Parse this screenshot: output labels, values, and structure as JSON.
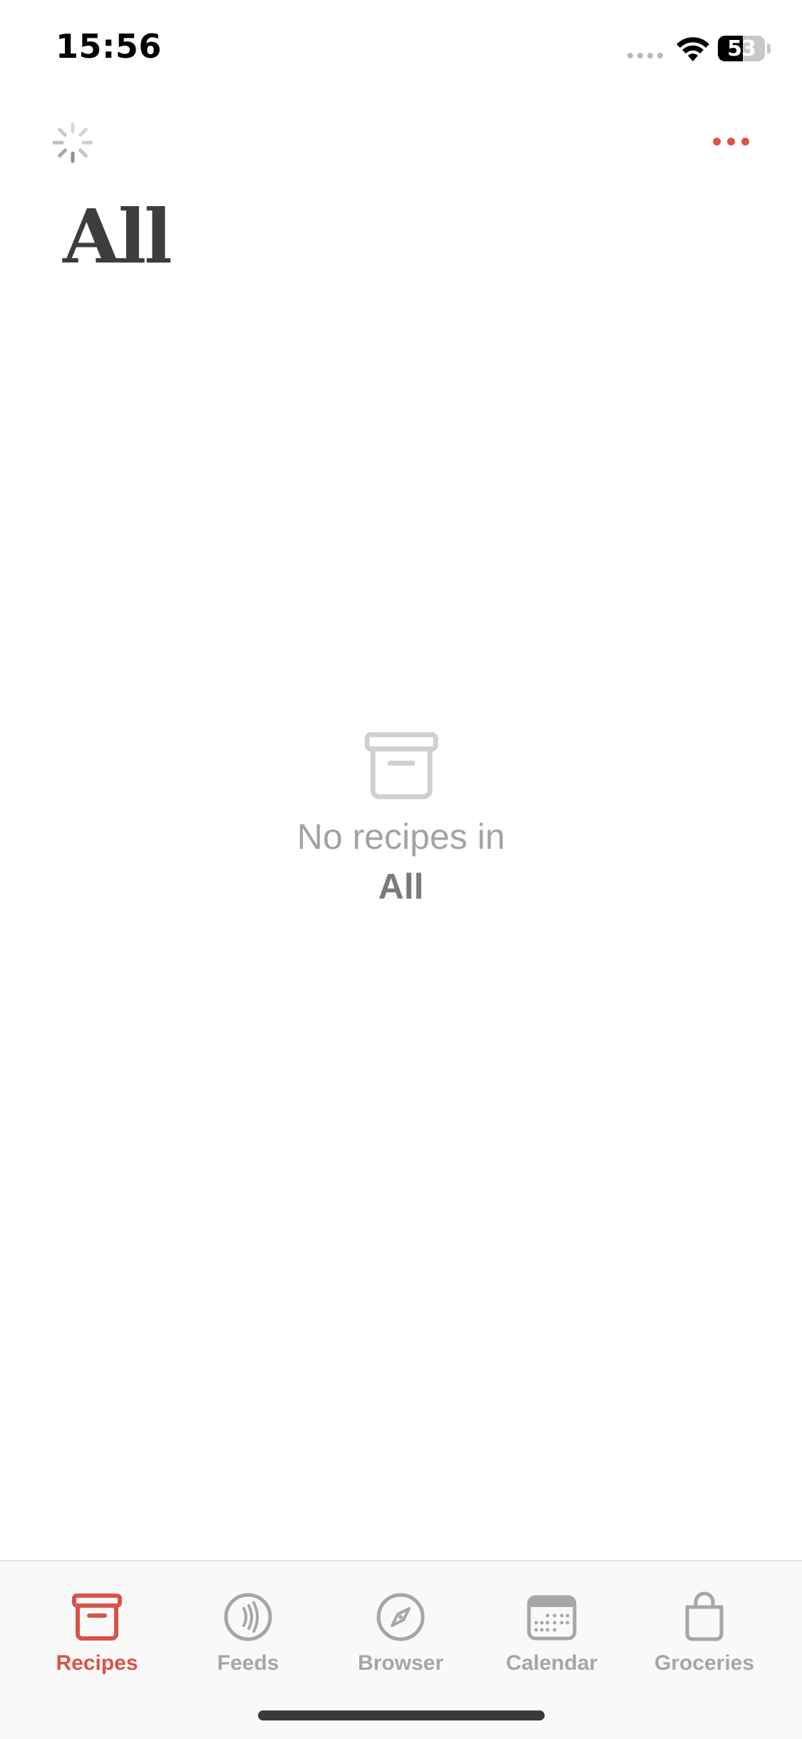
{
  "status_bar": {
    "time": "15:56",
    "battery_percent": "53",
    "battery_level": 0.53
  },
  "header": {
    "title": "All",
    "more_icon": "ellipsis-icon",
    "loading_icon": "spinner-icon"
  },
  "empty_state": {
    "icon": "archive-box-icon",
    "message": "No recipes in",
    "folder_name": "All"
  },
  "tab_bar": {
    "active_tab": "Recipes",
    "tabs": [
      {
        "label": "Recipes",
        "icon": "archive-box-icon"
      },
      {
        "label": "Feeds",
        "icon": "feed-icon"
      },
      {
        "label": "Browser",
        "icon": "compass-icon"
      },
      {
        "label": "Calendar",
        "icon": "calendar-icon"
      },
      {
        "label": "Groceries",
        "icon": "shopping-bag-icon"
      }
    ]
  },
  "colors": {
    "accent": "#d9534a",
    "inactive": "#a6a6a6",
    "title": "#3d3d3d"
  }
}
